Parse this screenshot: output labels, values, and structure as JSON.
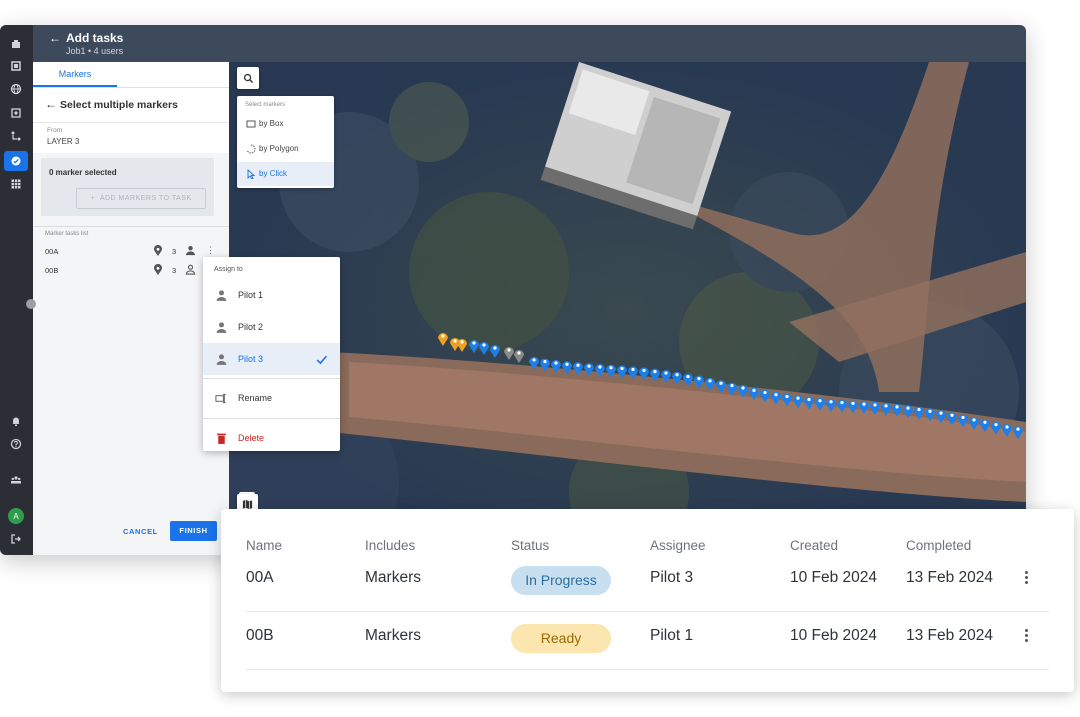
{
  "topbar": {
    "back_icon": "arrow-left-icon",
    "title": "Add tasks",
    "subtitle": "Job1  •  4 users"
  },
  "rail": {
    "avatar_letter": "A",
    "active_color": "#1a73e8"
  },
  "panel": {
    "tab": "Markers",
    "header": "Select multiple markers",
    "from_label": "From",
    "from_value": "LAYER 3",
    "selected_count": "0 marker selected",
    "add_button": "ADD MARKERS TO TASK",
    "list_title": "Marker tasks list",
    "markers": [
      {
        "name": "00A",
        "count": "3"
      },
      {
        "name": "00B",
        "count": "3"
      }
    ],
    "cancel": "CANCEL",
    "finish": "FINISH"
  },
  "select_menu": {
    "heading": "Select markers",
    "items": [
      {
        "label": "by Box",
        "icon": "box-select-icon"
      },
      {
        "label": "by Polygon",
        "icon": "polygon-select-icon"
      },
      {
        "label": "by Click",
        "icon": "cursor-click-icon"
      }
    ]
  },
  "context_menu": {
    "heading": "Assign to",
    "pilots": [
      "Pilot 1",
      "Pilot 2",
      "Pilot 3"
    ],
    "rename": "Rename",
    "delete": "Delete",
    "selected_pilot": "Pilot 3",
    "delete_color": "#c62828"
  },
  "tasks_table": {
    "headers": [
      "Name",
      "Includes",
      "Status",
      "Assignee",
      "Created",
      "Completed"
    ],
    "rows": [
      {
        "name": "00A",
        "includes": "Markers",
        "status": "In Progress",
        "assignee": "Pilot 3",
        "created": "10 Feb 2024",
        "completed": "13 Feb 2024"
      },
      {
        "name": "00B",
        "includes": "Markers",
        "status": "Ready",
        "assignee": "Pilot 1",
        "created": "10 Feb 2024",
        "completed": "13 Feb 2024"
      }
    ],
    "status_colors": {
      "in_progress_bg": "#c8dff0",
      "in_progress_fg": "#2e6e9e",
      "ready_bg": "#fbe6b0",
      "ready_fg": "#9b6a00"
    }
  }
}
